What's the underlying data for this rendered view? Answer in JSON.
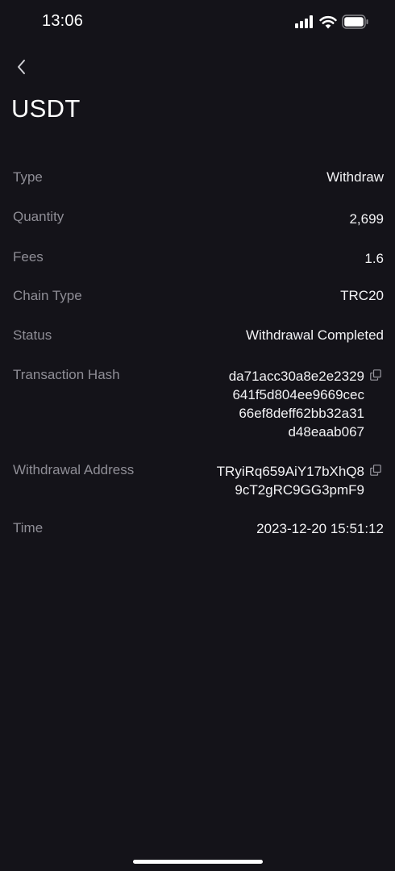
{
  "status_bar": {
    "time": "13:06",
    "icons": [
      "cellular-signal-icon",
      "wifi-icon",
      "battery-icon"
    ]
  },
  "header": {
    "back_icon": "chevron-left-icon",
    "title": "USDT"
  },
  "details": {
    "type": {
      "label": "Type",
      "value": "Withdraw"
    },
    "quantity": {
      "label": "Quantity",
      "value": "2,699"
    },
    "fees": {
      "label": "Fees",
      "value": "1.6"
    },
    "chain_type": {
      "label": "Chain Type",
      "value": "TRC20"
    },
    "status": {
      "label": "Status",
      "value": "Withdrawal Completed"
    },
    "transaction_hash": {
      "label": "Transaction Hash",
      "lines": [
        "da71acc30a8e2e2329",
        "641f5d804ee9669cec",
        "66ef8deff62bb32a31",
        "d48eaab067"
      ],
      "copy_icon": "copy-icon"
    },
    "withdrawal_address": {
      "label": "Withdrawal Address",
      "lines": [
        "TRyiRq659AiY17bXhQ8",
        "9cT2gRC9GG3pmF9"
      ],
      "copy_icon": "copy-icon"
    },
    "time": {
      "label": "Time",
      "value": "2023-12-20 15:51:12"
    }
  },
  "colors": {
    "background": "#141319",
    "label": "#8f8e96",
    "value": "#f3f3f5"
  }
}
